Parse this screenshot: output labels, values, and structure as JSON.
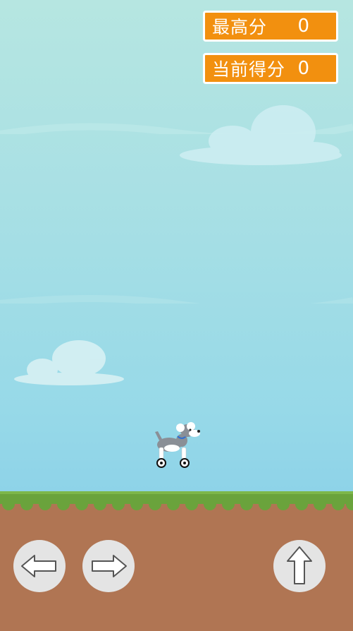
{
  "scoreboard": {
    "high_score_label": "最高分",
    "high_score_value": "0",
    "current_score_label": "当前得分",
    "current_score_value": "0"
  },
  "controls": {
    "left_icon": "arrow-left-icon",
    "right_icon": "arrow-right-icon",
    "jump_icon": "arrow-up-icon"
  },
  "colors": {
    "sky_top": "#b6e6e1",
    "sky_bottom": "#8ed3e8",
    "grass": "#6aa33c",
    "dirt": "#b07553",
    "score_box": "#f2900f",
    "button": "#e4e4e4"
  }
}
